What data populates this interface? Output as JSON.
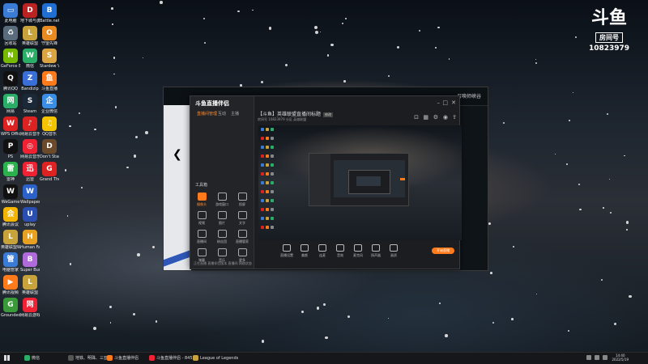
{
  "watermark": {
    "logo": "斗鱼",
    "room_label": "房间号",
    "room_number": "10823979"
  },
  "desktop_icons": [
    {
      "label": "此电脑",
      "color": "#3a7bd5",
      "glyph": "▭"
    },
    {
      "label": "地下城与勇士",
      "color": "#b22",
      "glyph": "D"
    },
    {
      "label": "Battle.net",
      "color": "#1e6fd1",
      "glyph": "B"
    },
    {
      "label": "回收站",
      "color": "#5a6b7c",
      "glyph": "♻"
    },
    {
      "label": "英雄联盟",
      "color": "#c8a23a",
      "glyph": "L"
    },
    {
      "label": "守望先锋",
      "color": "#e88a20",
      "glyph": "O"
    },
    {
      "label": "GeForce Experience",
      "color": "#76b900",
      "glyph": "N"
    },
    {
      "label": "微信",
      "color": "#2aae67",
      "glyph": "W"
    },
    {
      "label": "Stardew Valley",
      "color": "#d9a441",
      "glyph": "S"
    },
    {
      "label": "腾讯QQ",
      "color": "#111",
      "glyph": "Q"
    },
    {
      "label": "Bandizip",
      "color": "#3a6fd8",
      "glyph": "Z"
    },
    {
      "label": "斗鱼直播",
      "color": "#ff7a1a",
      "glyph": "鱼"
    },
    {
      "label": "网易",
      "color": "#2aae67",
      "glyph": "网"
    },
    {
      "label": "Steam",
      "color": "#1b2838",
      "glyph": "S"
    },
    {
      "label": "企业微信",
      "color": "#3a8ee6",
      "glyph": "企"
    },
    {
      "label": "WPS Office",
      "color": "#d22",
      "glyph": "W"
    },
    {
      "label": "网易云音乐",
      "color": "#d22",
      "glyph": "♪"
    },
    {
      "label": "QQ音乐",
      "color": "#f5c400",
      "glyph": "♫"
    },
    {
      "label": "PS",
      "color": "#111",
      "glyph": "P"
    },
    {
      "label": "网易云音乐",
      "color": "#e23",
      "glyph": "◎"
    },
    {
      "label": "Don't Starve Together",
      "color": "#6a4a2a",
      "glyph": "D"
    },
    {
      "label": "雷神",
      "color": "#2bb24c",
      "glyph": "雷"
    },
    {
      "label": "迅雷",
      "color": "#e23",
      "glyph": "迅"
    },
    {
      "label": "Grand Theft",
      "color": "#d22",
      "glyph": "G"
    },
    {
      "label": "WeGame",
      "color": "#111",
      "glyph": "W"
    },
    {
      "label": "Wallpaper Engine",
      "color": "#2a62c9",
      "glyph": "W"
    },
    {
      "label": "",
      "color": "#222",
      "glyph": ""
    },
    {
      "label": "腾讯会议",
      "color": "#f5b400",
      "glyph": "会"
    },
    {
      "label": "uplay",
      "color": "#2a4fb0",
      "glyph": "U"
    },
    {
      "label": "",
      "color": "#222",
      "glyph": ""
    },
    {
      "label": "英雄联盟WeGame版",
      "color": "#c8a23a",
      "glyph": "L"
    },
    {
      "label": "Human Fall Flat",
      "color": "#e8a020",
      "glyph": "H"
    },
    {
      "label": "",
      "color": "#222",
      "glyph": ""
    },
    {
      "label": "电脑管家",
      "color": "#3a7bd5",
      "glyph": "管"
    },
    {
      "label": "Super Bunny Man",
      "color": "#b06ad9",
      "glyph": "B"
    },
    {
      "label": "",
      "color": "#222",
      "glyph": ""
    },
    {
      "label": "腾讯视频",
      "color": "#ff7a1a",
      "glyph": "▶"
    },
    {
      "label": "英雄联盟",
      "color": "#c8a23a",
      "glyph": "L"
    },
    {
      "label": "",
      "color": "#222",
      "glyph": ""
    },
    {
      "label": "Grounded",
      "color": "#3a9a3a",
      "glyph": "G"
    },
    {
      "label": "网易云游戏",
      "color": "#e23",
      "glyph": "网"
    },
    {
      "label": "",
      "color": "#222",
      "glyph": ""
    }
  ],
  "client": {
    "top_right": "召唤师峡谷"
  },
  "app": {
    "brand": "斗鱼直播伴侣",
    "tabs": [
      "直播间管理",
      "互动",
      "主播"
    ],
    "section": "工具箱",
    "tools": [
      "摄像头",
      "游戏窗口",
      "投屏",
      "视频",
      "图片",
      "文字",
      "直播间",
      "粉丝团",
      "直播管家",
      "弹幕",
      "音乐",
      "更多"
    ],
    "footer": "正在直播   直播伴侣版本   直播间   网络状态",
    "stream_title": "【斗鱼】英雄联盟直播间标题",
    "badge": "修改",
    "meta": "房间号 10823979   分区 英雄联盟",
    "bottom_tools": [
      "直播设置",
      "美颜",
      "连麦",
      "音效",
      "麦克风",
      "扬声器",
      "画质"
    ],
    "start_label": "开始直播"
  },
  "taskbar": {
    "items": [
      {
        "label": "微信",
        "color": "#2aae67"
      },
      {
        "label": "地铁、明珠、三亚...",
        "color": "#555"
      },
      {
        "label": "斗鱼直播伴侣",
        "color": "#ff7a1a"
      },
      {
        "label": "斗鱼直播伴侣 - 8453...",
        "color": "#e23"
      },
      {
        "label": "League of Legends",
        "color": "#c8a23a"
      }
    ],
    "time": "14:40",
    "date": "2022/5/19"
  }
}
